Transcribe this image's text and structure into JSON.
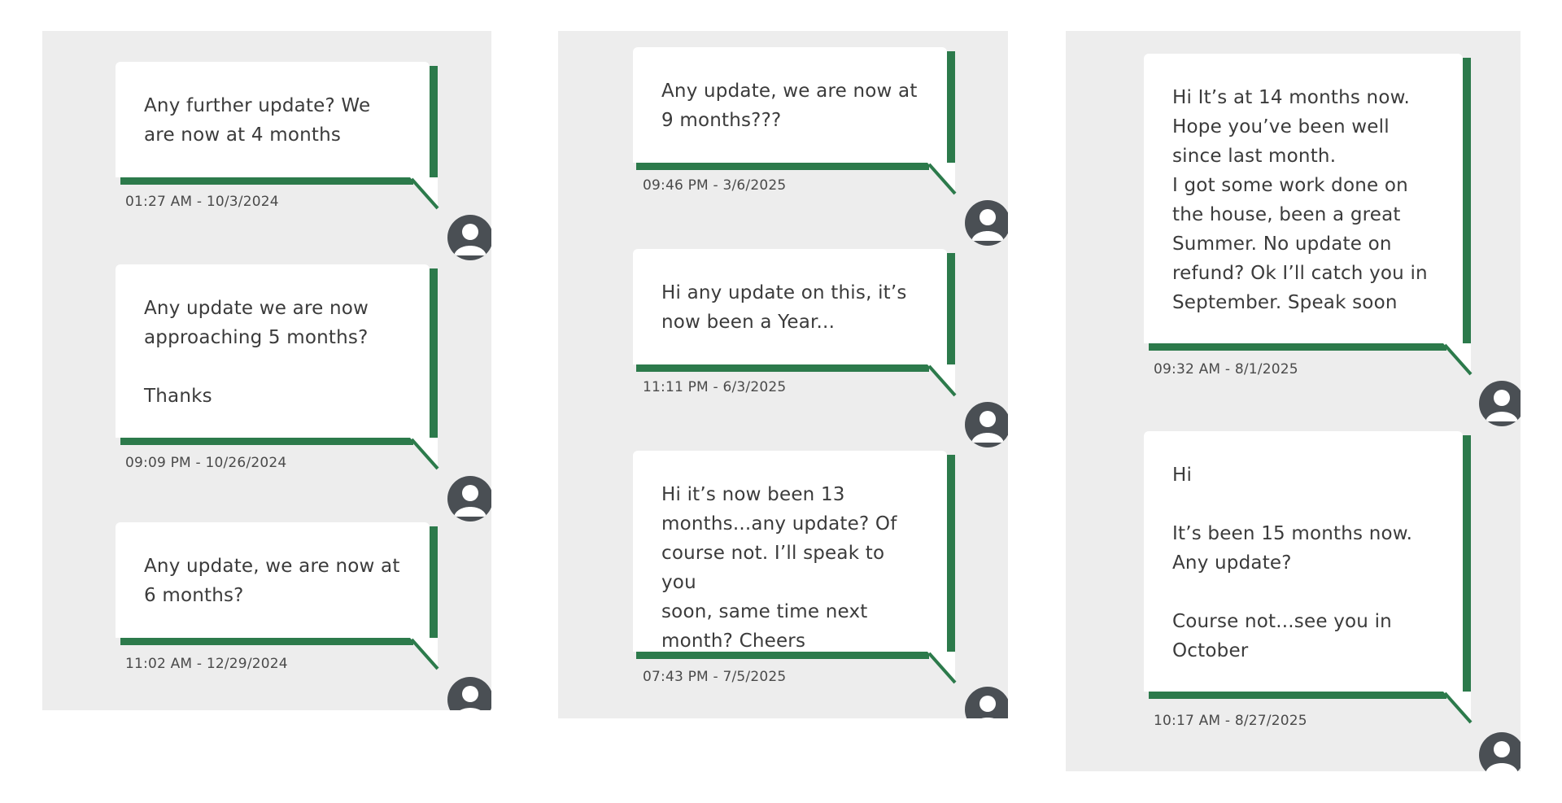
{
  "conversation": {
    "panels": [
      {
        "messages": [
          {
            "text": "Any further update? We\nare now at 4 months",
            "timestamp": "01:27 AM - 10/3/2024"
          },
          {
            "text": "Any update we are now\napproaching 5 months?\n\nThanks",
            "timestamp": "09:09 PM - 10/26/2024"
          },
          {
            "text": "Any update, we are now at\n6 months?",
            "timestamp": "11:02 AM - 12/29/2024"
          }
        ]
      },
      {
        "messages": [
          {
            "text": "Any update, we are now at\n9 months???",
            "timestamp": "09:46 PM - 3/6/2025"
          },
          {
            "text": "Hi any update on this, it’s\nnow been a Year...",
            "timestamp": "11:11 PM - 6/3/2025"
          },
          {
            "text": "Hi it’s now been 13\nmonths...any update? Of\ncourse not. I’ll speak to you\nsoon, same time next\nmonth? Cheers",
            "timestamp": "07:43 PM - 7/5/2025"
          }
        ]
      },
      {
        "messages": [
          {
            "text": "Hi It’s at 14 months now.\nHope you’ve been well\nsince last month.\nI got some work done on\nthe house, been a great\nSummer. No update on\nrefund? Ok I’ll catch you in\nSeptember. Speak soon",
            "timestamp": "09:32 AM - 8/1/2025"
          },
          {
            "text": "Hi\n\nIt’s been 15 months now.\nAny update?\n\nCourse not...see you in\nOctober",
            "timestamp": "10:17 AM - 8/27/2025"
          }
        ]
      }
    ],
    "colors": {
      "panel_background": "#ededed",
      "bubble_background": "#ffffff",
      "bubble_accent": "#2c7a4b",
      "avatar": "#4a4f54"
    },
    "icons": {
      "avatar": "user-avatar-icon"
    }
  }
}
